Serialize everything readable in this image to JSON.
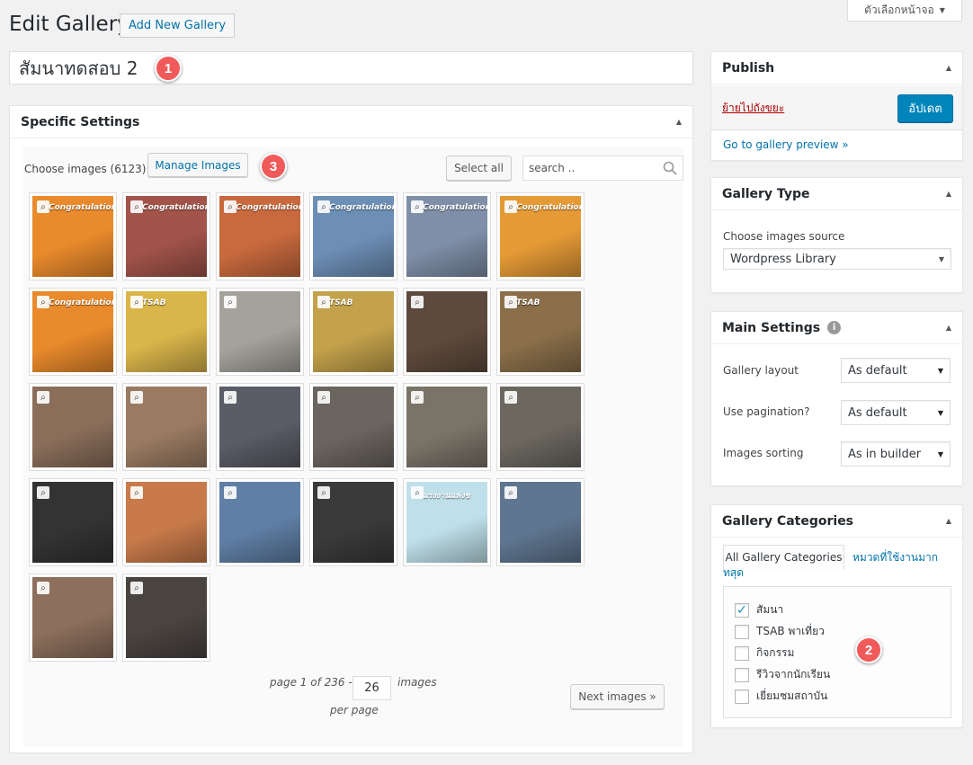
{
  "screen_options": {
    "label": "ตัวเลือกหน้าจอ",
    "arrow": "▼"
  },
  "page_title": "Edit Gallery",
  "add_new_label": "Add New Gallery",
  "gallery_title": "สัมนาทดสอบ 2",
  "badges": [
    "1",
    "2",
    "3"
  ],
  "specific_settings": {
    "title": "Specific Settings",
    "choose_label": "Choose images (6123)",
    "manage_label": "Manage Images",
    "select_all_label": "Select all",
    "search_placeholder": "search ..",
    "thumbnails": [
      {
        "caption": "Congratulations",
        "color": "#e98a2c"
      },
      {
        "caption": "Congratulations",
        "color": "#a2544a"
      },
      {
        "caption": "Congratulations",
        "color": "#c96a3e"
      },
      {
        "caption": "Congratulations",
        "color": "#6d8fb6"
      },
      {
        "caption": "Congratulations",
        "color": "#7f8fa8"
      },
      {
        "caption": "Congratulations",
        "color": "#e59a36"
      },
      {
        "caption": "Congratulations",
        "color": "#e98a2c"
      },
      {
        "caption": "TSAB",
        "color": "#d9b54a"
      },
      {
        "caption": "",
        "color": "#a5a29c"
      },
      {
        "caption": "TSAB",
        "color": "#c4a24b"
      },
      {
        "caption": "",
        "color": "#5e4a3c"
      },
      {
        "caption": "TSAB",
        "color": "#8a6f4a"
      },
      {
        "caption": "",
        "color": "#8a6e5a"
      },
      {
        "caption": "",
        "color": "#9a7b62"
      },
      {
        "caption": "",
        "color": "#5a5c66"
      },
      {
        "caption": "",
        "color": "#6b6560"
      },
      {
        "caption": "",
        "color": "#7a7468"
      },
      {
        "caption": "",
        "color": "#6c6860"
      },
      {
        "caption": "",
        "color": "#333333"
      },
      {
        "caption": "",
        "color": "#c87a4a"
      },
      {
        "caption": "",
        "color": "#5f7fa5"
      },
      {
        "caption": "",
        "color": "#3b3a3a"
      },
      {
        "caption": "แรงงานแห่งช",
        "color": "#bfe0ea"
      },
      {
        "caption": "",
        "color": "#5f7690"
      },
      {
        "caption": "",
        "color": "#8c6f5c"
      },
      {
        "caption": "",
        "color": "#4a4440"
      }
    ],
    "pager": {
      "text": "page 1 of 236 -",
      "per_page_value": "26",
      "images_label": "images",
      "per_page_label": "per page",
      "next_label": "Next images »"
    }
  },
  "publish": {
    "title": "Publish",
    "trash_label": "ย้ายไปถังขยะ",
    "update_label": "อัปเดต",
    "preview_label": "Go to gallery preview »"
  },
  "gallery_type": {
    "title": "Gallery Type",
    "source_label": "Choose images source",
    "source_value": "Wordpress Library"
  },
  "main_settings": {
    "title": "Main Settings",
    "info": "i",
    "rows": [
      {
        "label": "Gallery layout",
        "value": "As default"
      },
      {
        "label": "Use pagination?",
        "value": "As default"
      },
      {
        "label": "Images sorting",
        "value": "As in builder"
      }
    ]
  },
  "categories": {
    "title": "Gallery Categories",
    "tab_all": "All Gallery Categories",
    "tab_popular": "หมวดที่ใช้งานมากที่สุด",
    "items": [
      {
        "label": "สัมนา",
        "checked": true
      },
      {
        "label": "TSAB พาเที่ยว",
        "checked": false
      },
      {
        "label": "กิจกรรม",
        "checked": false
      },
      {
        "label": "รีวิวจากนักเรียน",
        "checked": false
      },
      {
        "label": "เยี่ยมชมสถาบัน",
        "checked": false
      }
    ]
  }
}
